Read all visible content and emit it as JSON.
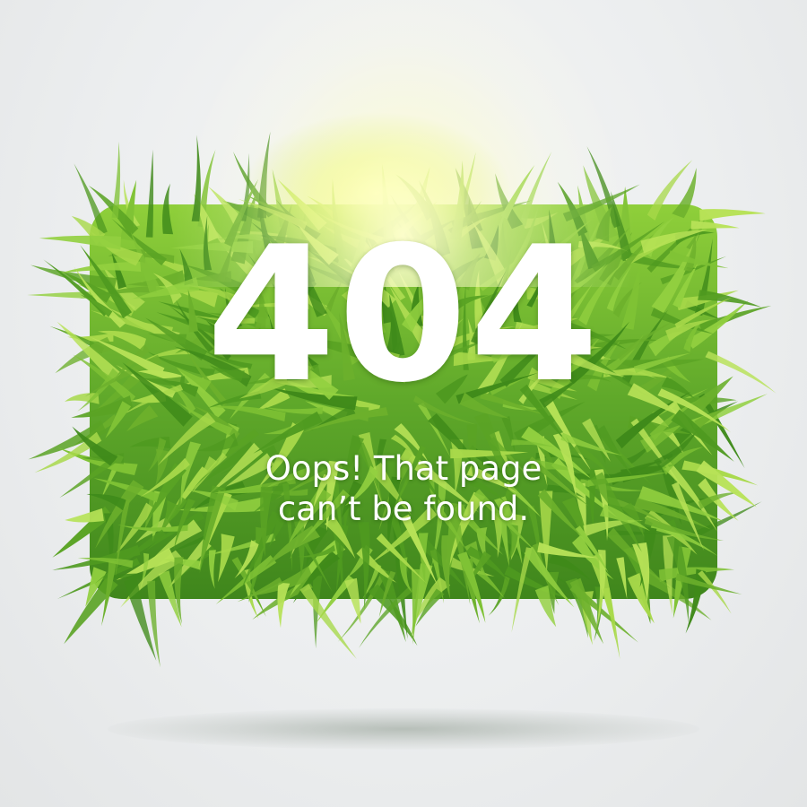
{
  "error": {
    "code": "404",
    "message_line1": "Oops! That page",
    "message_line2": "can’t be found."
  },
  "illustration": {
    "name": "grass-sign",
    "colors": {
      "grass_dark": "#3f8a1a",
      "grass_mid": "#6cb02c",
      "grass_light": "#a8d94a",
      "highlight": "#e8f55a",
      "background": "#eceeef"
    }
  }
}
